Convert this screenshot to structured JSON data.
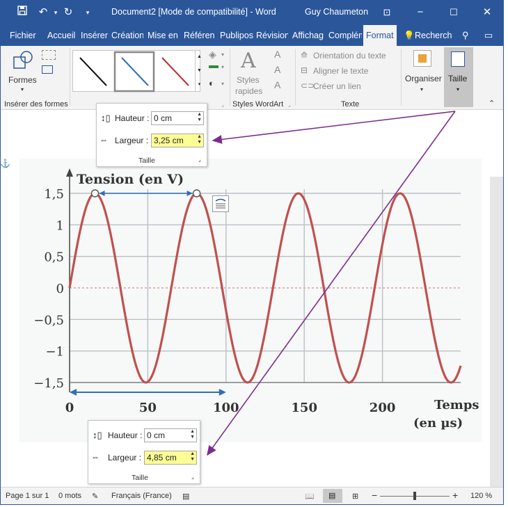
{
  "titlebar": {
    "doc_title": "Document2 [Mode de compatibilité]  -  Word",
    "user": "Guy Chaumeton"
  },
  "tabs": [
    {
      "label": "Fichier"
    },
    {
      "label": "Accueil"
    },
    {
      "label": "Insérer"
    },
    {
      "label": "Création"
    },
    {
      "label": "Mise en"
    },
    {
      "label": "Référen"
    },
    {
      "label": "Publipos"
    },
    {
      "label": "Révision"
    },
    {
      "label": "Affichag"
    },
    {
      "label": "Complém"
    },
    {
      "label": "Format"
    },
    {
      "label": "Recherch"
    }
  ],
  "ribbon": {
    "formes_label": "Formes",
    "inserer_formes_group": "Insérer des formes",
    "styles_rapides": "Styles\nrapides",
    "styles_rapides_l1": "Styles",
    "styles_rapides_l2": "rapides",
    "styles_wordart_group": "Styles WordArt",
    "orientation_texte": "Orientation du texte",
    "aligner_texte": "Aligner le texte",
    "creer_lien": "Créer un lien",
    "texte_group": "Texte",
    "organiser": "Organiser",
    "taille": "Taille",
    "line_colors": [
      "#111111",
      "#2e6fb5",
      "#c0282d"
    ]
  },
  "popup_top": {
    "hauteur_label": "Hauteur :",
    "hauteur_value": "0 cm",
    "largeur_label": "Largeur :",
    "largeur_value": "3,25 cm",
    "caption": "Taille"
  },
  "popup_bottom": {
    "hauteur_label": "Hauteur :",
    "hauteur_value": "0 cm",
    "largeur_label": "Largeur :",
    "largeur_value": "4,85 cm",
    "caption": "Taille"
  },
  "chart_data": {
    "type": "line",
    "title": "Tension (en V)",
    "xlabel": "Temps\n(en µs)",
    "xlabel_l1": "Temps",
    "xlabel_l2": "(en µs)",
    "ylabel": "Tension (en V)",
    "x_ticks": [
      "0",
      "50",
      "100",
      "150",
      "200"
    ],
    "y_ticks": [
      "1,5",
      "1",
      "0,5",
      "0",
      "−0,5",
      "−1",
      "−1,5"
    ],
    "xlim": [
      0,
      250
    ],
    "ylim": [
      -1.5,
      1.5
    ],
    "grid": true,
    "series": [
      {
        "amplitude": 1.5,
        "period_us": 65,
        "color": "#c0504d"
      }
    ],
    "markers": {
      "peak1_t": 16.25,
      "peak2_t": 81.25,
      "horizontal_arrow_t": [
        0,
        100
      ]
    }
  },
  "statusbar": {
    "page": "Page 1 sur 1",
    "words": "0 mots",
    "language": "Français (France)",
    "zoom": "120 %"
  },
  "colors": {
    "accent": "#2b579a",
    "highlight": "#fdfd96",
    "arrow": "#7b2d8e",
    "sine": "#c0504d",
    "measure_line": "#2e6fb5"
  }
}
